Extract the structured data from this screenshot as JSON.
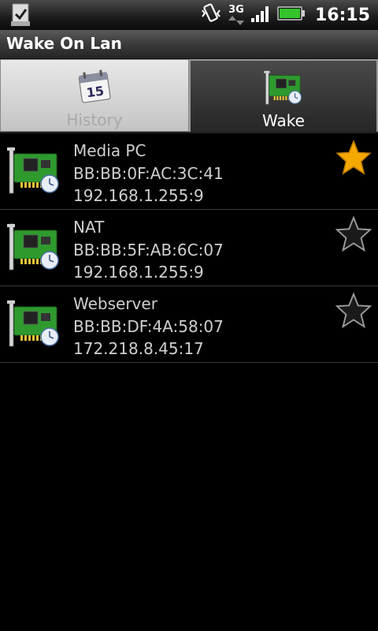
{
  "status_bar": {
    "network": "3G",
    "time": "16:15"
  },
  "app": {
    "title": "Wake On Lan"
  },
  "tabs": [
    {
      "label": "History",
      "icon": "calendar-icon",
      "calendar_day": "15",
      "selected": false
    },
    {
      "label": "Wake",
      "icon": "network-card-icon",
      "selected": true
    }
  ],
  "devices": [
    {
      "name": "Media PC",
      "mac": "BB:BB:0F:AC:3C:41",
      "address": "192.168.1.255:9",
      "favorite": true
    },
    {
      "name": "NAT",
      "mac": "BB:BB:5F:AB:6C:07",
      "address": "192.168.1.255:9",
      "favorite": false
    },
    {
      "name": "Webserver",
      "mac": "BB:BB:DF:4A:58:07",
      "address": "172.218.8.45:17",
      "favorite": false
    }
  ],
  "colors": {
    "star_favorite": "#f5a800",
    "star_outline": "#9a9a9a",
    "card_green": "#2e9a2e",
    "battery_green": "#35c42b"
  }
}
